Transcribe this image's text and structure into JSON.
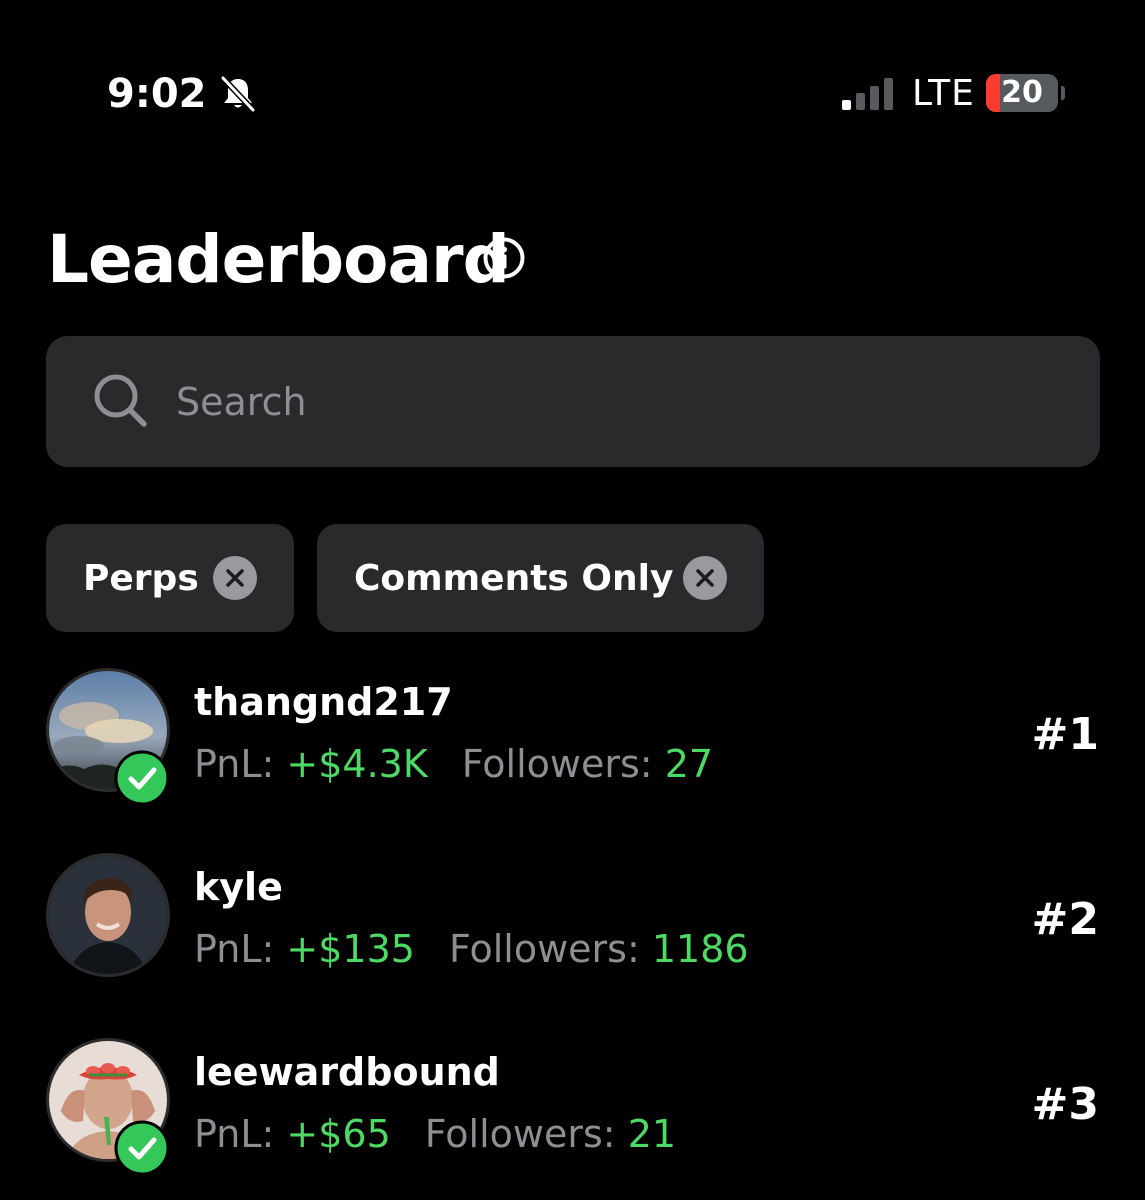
{
  "status_bar": {
    "time": "9:02",
    "network": "LTE",
    "battery_level": "20",
    "battery_fraction": 0.2,
    "silent_icon": "bell-slash-icon",
    "signal_icon": "signal-bars-icon"
  },
  "header": {
    "title": "Leaderboard",
    "info_icon": "info-icon"
  },
  "search": {
    "placeholder": "Search",
    "value": "",
    "icon": "search-icon"
  },
  "filters": [
    {
      "label": "Perps",
      "remove_icon": "close-icon"
    },
    {
      "label": "Comments Only",
      "remove_icon": "close-icon"
    }
  ],
  "leaderboard": [
    {
      "username": "thangnd217",
      "pnl_label": "PnL:",
      "pnl": "+$4.3K",
      "followers_label": "Followers:",
      "followers": "27",
      "rank": "#1",
      "verified": true
    },
    {
      "username": "kyle",
      "pnl_label": "PnL:",
      "pnl": "+$135",
      "followers_label": "Followers:",
      "followers": "1186",
      "rank": "#2",
      "verified": false
    },
    {
      "username": "leewardbound",
      "pnl_label": "PnL:",
      "pnl": "+$65",
      "followers_label": "Followers:",
      "followers": "21",
      "rank": "#3",
      "verified": true
    }
  ],
  "colors": {
    "background": "#000000",
    "surface": "#2a2a2c",
    "positive": "#4cd964",
    "muted_text": "#8e8e93",
    "verified_badge": "#34c759",
    "battery_low": "#ff3b30"
  }
}
